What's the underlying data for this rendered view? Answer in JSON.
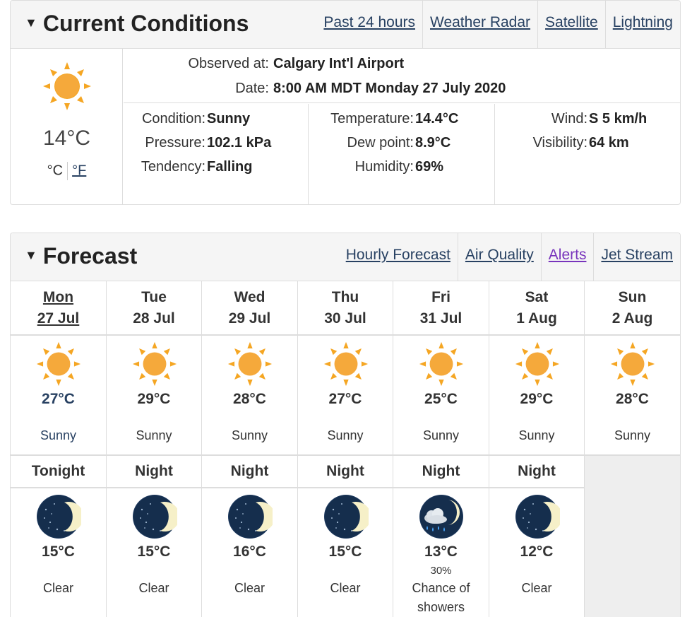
{
  "current": {
    "title": "Current Conditions",
    "links": [
      "Past 24 hours",
      "Weather Radar",
      "Satellite",
      "Lightning"
    ],
    "icon": "sun-icon",
    "temp": "14°C",
    "unit_c": "°C",
    "unit_f": "°F",
    "observed_label": "Observed at:",
    "observed_value": "Calgary Int'l Airport",
    "date_label": "Date:",
    "date_value": "8:00 AM MDT Monday 27 July 2020",
    "condition_label": "Condition:",
    "condition_value": "Sunny",
    "pressure_label": "Pressure:",
    "pressure_value": "102.1 kPa",
    "tendency_label": "Tendency:",
    "tendency_value": "Falling",
    "temperature_label": "Temperature:",
    "temperature_value": "14.4°C",
    "dewpoint_label": "Dew point:",
    "dewpoint_value": "8.9°C",
    "humidity_label": "Humidity:",
    "humidity_value": "69%",
    "wind_label": "Wind:",
    "wind_value": "S 5 km/h",
    "visibility_label": "Visibility:",
    "visibility_value": "64 km"
  },
  "forecast": {
    "title": "Forecast",
    "links": [
      "Hourly Forecast",
      "Air Quality",
      "Alerts",
      "Jet Stream"
    ],
    "days": [
      {
        "dow": "Mon",
        "date": "27 Jul",
        "temp": "27°C",
        "desc": "Sunny",
        "night_label": "Tonight",
        "night_temp": "15°C",
        "night_desc": "Clear",
        "night_icon": "moon-icon"
      },
      {
        "dow": "Tue",
        "date": "28 Jul",
        "temp": "29°C",
        "desc": "Sunny",
        "night_label": "Night",
        "night_temp": "15°C",
        "night_desc": "Clear",
        "night_icon": "moon-icon"
      },
      {
        "dow": "Wed",
        "date": "29 Jul",
        "temp": "28°C",
        "desc": "Sunny",
        "night_label": "Night",
        "night_temp": "16°C",
        "night_desc": "Clear",
        "night_icon": "moon-icon"
      },
      {
        "dow": "Thu",
        "date": "30 Jul",
        "temp": "27°C",
        "desc": "Sunny",
        "night_label": "Night",
        "night_temp": "15°C",
        "night_desc": "Clear",
        "night_icon": "moon-icon"
      },
      {
        "dow": "Fri",
        "date": "31 Jul",
        "temp": "25°C",
        "desc": "Sunny",
        "night_label": "Night",
        "night_temp": "13°C",
        "night_pop": "30%",
        "night_desc": "Chance of showers",
        "night_icon": "moon-cloud-rain-icon"
      },
      {
        "dow": "Sat",
        "date": "1 Aug",
        "temp": "29°C",
        "desc": "Sunny",
        "night_label": "Night",
        "night_temp": "12°C",
        "night_desc": "Clear",
        "night_icon": "moon-icon"
      },
      {
        "dow": "Sun",
        "date": "2 Aug",
        "temp": "28°C",
        "desc": "Sunny"
      }
    ]
  },
  "colors": {
    "link": "#284162",
    "visited": "#7834bc",
    "sun": "#f5a623",
    "night": "#1e3a5f"
  }
}
